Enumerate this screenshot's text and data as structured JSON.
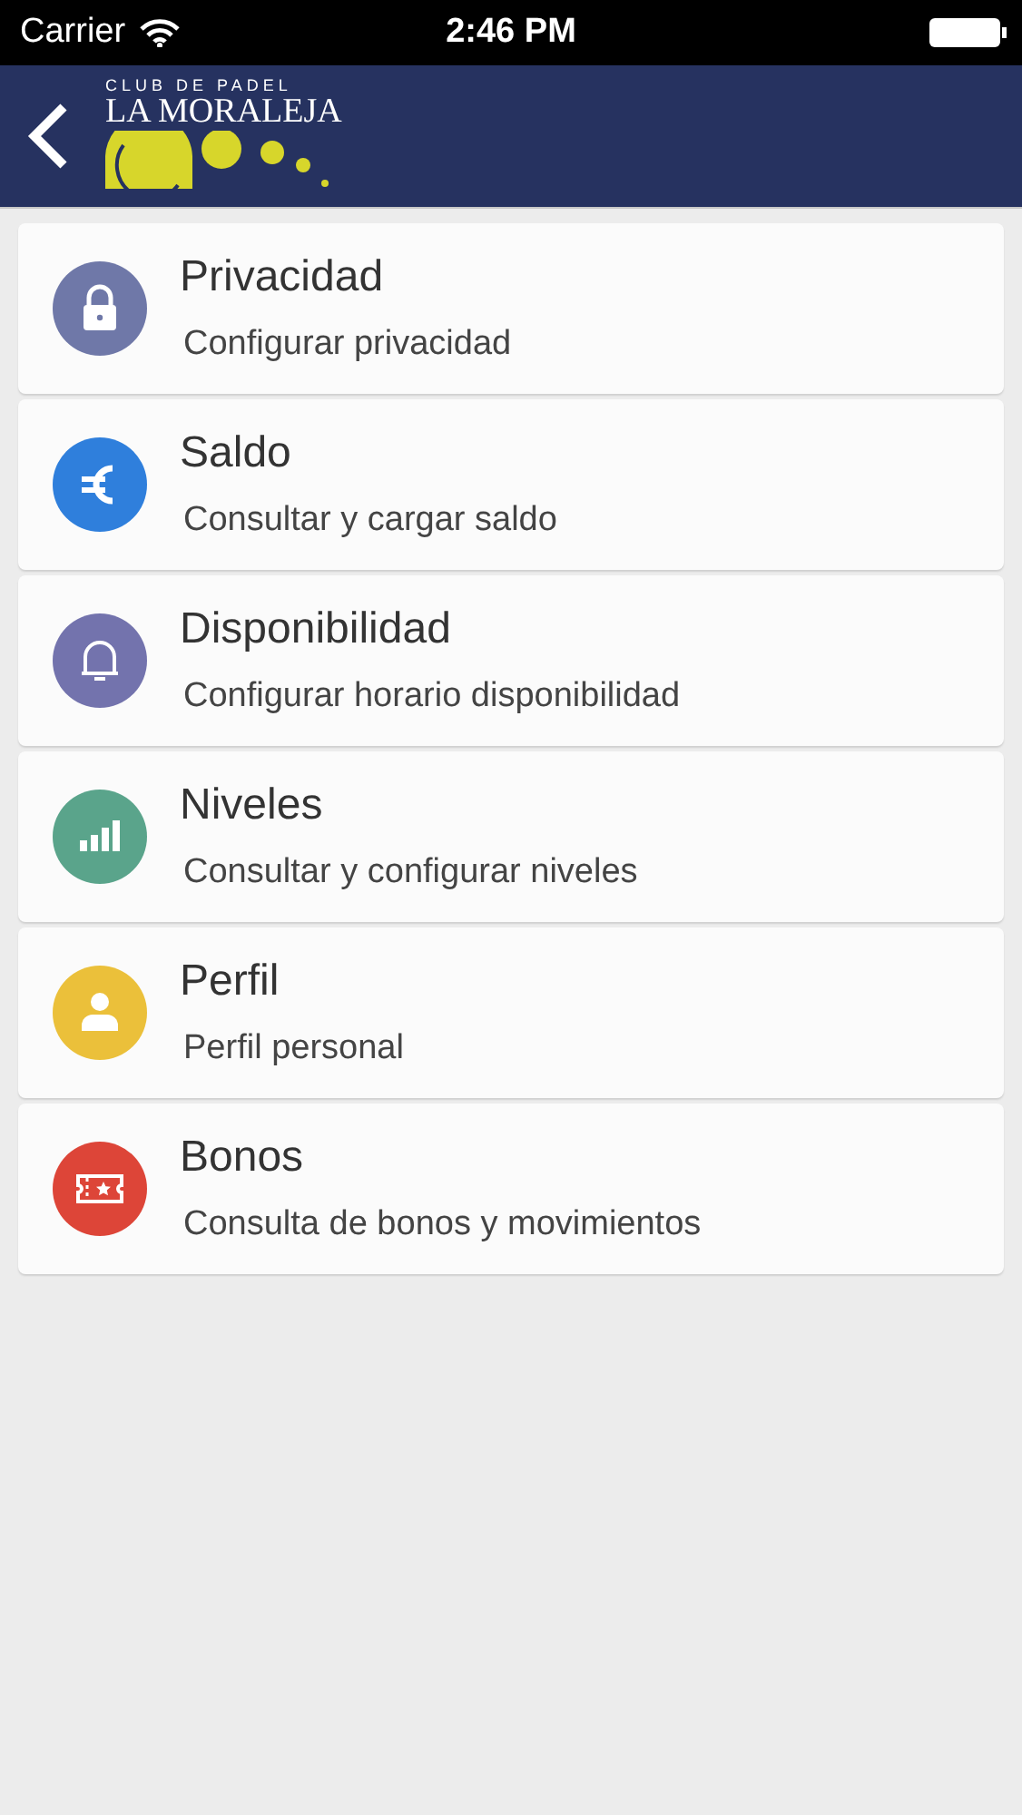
{
  "status_bar": {
    "carrier": "Carrier",
    "time": "2:46 PM"
  },
  "nav_bar": {
    "logo_small": "CLUB DE PADEL",
    "logo_name": "LA MORALEJA"
  },
  "menu": [
    {
      "kind": "lock",
      "color": "#6f78a8",
      "title": "Privacidad",
      "subtitle": "Configurar privacidad"
    },
    {
      "kind": "euro",
      "color": "#2f7fdc",
      "title": "Saldo",
      "subtitle": "Consultar y cargar saldo"
    },
    {
      "kind": "bell",
      "color": "#7373ad",
      "title": "Disponibilidad",
      "subtitle": "Configurar horario disponibilidad"
    },
    {
      "kind": "bars",
      "color": "#5aa48b",
      "title": "Niveles",
      "subtitle": "Consultar y configurar niveles"
    },
    {
      "kind": "person",
      "color": "#ebc03a",
      "title": "Perfil",
      "subtitle": "Perfil personal"
    },
    {
      "kind": "ticket",
      "color": "#dd4538",
      "title": "Bonos",
      "subtitle": "Consulta de bonos y movimientos"
    }
  ]
}
